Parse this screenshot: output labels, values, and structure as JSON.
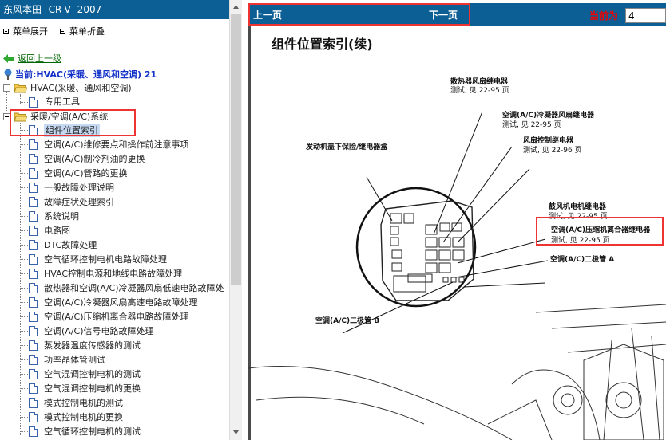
{
  "left_pane": {
    "title": "东风本田--CR-V--2007",
    "menu": {
      "expand": "菜单展开",
      "collapse": "菜单折叠"
    },
    "back": "返回上一级",
    "current": "当前:HVAC(采暖、通风和空调) 21",
    "tree": {
      "root_folder": "HVAC(采暖、通风和空调)",
      "root_children": [
        "专用工具"
      ],
      "sub_folder": "采暖/空调(A/C)系统",
      "items": [
        "组件位置索引",
        "空调(A/C)维修要点和操作前注意事项",
        "空调(A/C)制冷剂油的更换",
        "空调(A/C)管路的更换",
        "一般故障处理说明",
        "故障症状处理索引",
        "系统说明",
        "电路图",
        "DTC故障处理",
        "空气循环控制电机电路故障处理",
        "HVAC控制电源和地线电路故障处理",
        "散热器和空调(A/C)冷凝器风扇低速电路故障处",
        "空调(A/C)冷凝器风扇高速电路故障处理",
        "空调(A/C)压缩机离合器电路故障处理",
        "空调(A/C)信号电路故障处理",
        "蒸发器温度传感器的测试",
        "功率晶体管测试",
        "空气混调控制电机的测试",
        "空气混调控制电机的更换",
        "模式控制电机的测试",
        "模式控制电机的更换",
        "空气循环控制电机的测试"
      ],
      "selected_index": 0
    }
  },
  "right_pane": {
    "prev": "上一页",
    "next": "下一页",
    "page_label": "当前为",
    "page_value": "4",
    "doc": {
      "title": "组件位置索引(续)",
      "labels": {
        "l1": "散热器风扇继电器",
        "l1_sub": "测试, 见 22-95 页",
        "l2": "空调(A/C)冷凝器风扇继电器",
        "l2_sub": "测试, 见 22-95 页",
        "l3": "风扇控制继电器",
        "l3_sub": "测试, 见 22-96 页",
        "l4": "发动机盖下保险/继电器盒",
        "l5": "鼓风机电机继电器",
        "l5_sub": "测试, 见 22-95 页",
        "l6": "空调(A/C)压缩机离合器继电器",
        "l6_sub": "测试, 见 22-95 页",
        "l7": "空调(A/C)二极管 A",
        "l8": "空调(A/C)二极管 B"
      }
    }
  },
  "colors": {
    "titlebar": "#0b5f94",
    "highlight": "#e33333",
    "link": "#006600",
    "current": "#1030c8",
    "selected": "#c6d9f2"
  }
}
